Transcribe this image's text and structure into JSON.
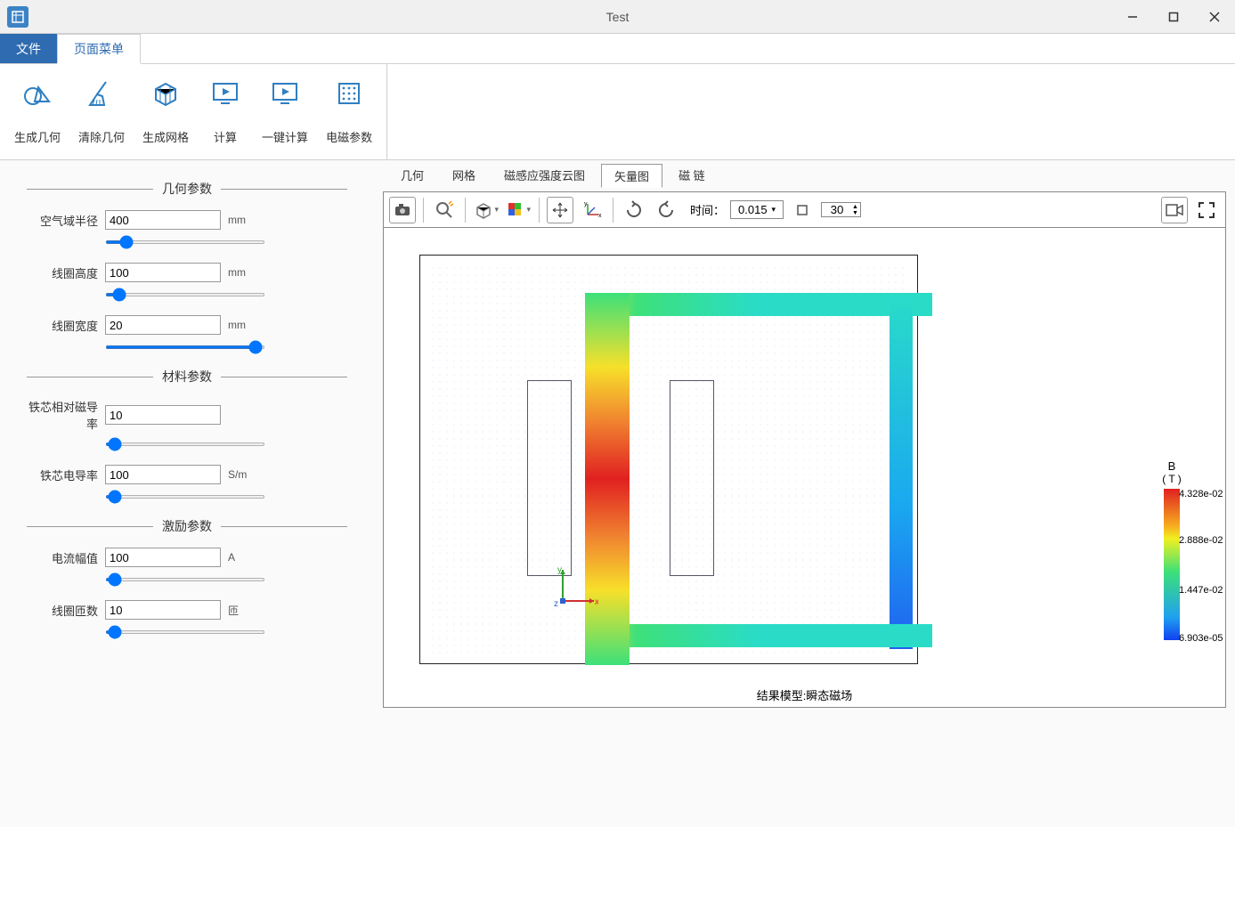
{
  "window": {
    "title": "Test"
  },
  "menubar": {
    "file": "文件",
    "page_menu": "页面菜单"
  },
  "ribbon": {
    "gen_geom": "生成几何",
    "clear_geom": "清除几何",
    "gen_mesh": "生成网格",
    "compute": "计算",
    "onekey": "一键计算",
    "em_params": "电磁参数"
  },
  "sections": {
    "geom": "几何参数",
    "material": "材料参数",
    "excitation": "激励参数"
  },
  "params": {
    "air_radius": {
      "label": "空气域半径",
      "value": "400",
      "unit": "mm"
    },
    "coil_height": {
      "label": "线圈高度",
      "value": "100",
      "unit": "mm"
    },
    "coil_width": {
      "label": "线圈宽度",
      "value": "20",
      "unit": "mm"
    },
    "perm": {
      "label": "铁芯相对磁导率",
      "value": "10",
      "unit": ""
    },
    "conduct": {
      "label": "铁芯电导率",
      "value": "100",
      "unit": "S/m"
    },
    "curr_amp": {
      "label": "电流幅值",
      "value": "100",
      "unit": "A"
    },
    "turns": {
      "label": "线圈匝数",
      "value": "10",
      "unit": "匝"
    }
  },
  "result_tabs": {
    "geom": "几何",
    "mesh": "网格",
    "bcontour": "磁感应强度云图",
    "vector": "矢量图",
    "flux": "磁 链"
  },
  "toolbar": {
    "time_label": "时间：",
    "time_value": "0.015",
    "frame": "30"
  },
  "legend": {
    "title1": "B",
    "title2": "( T )",
    "t0": "4.328e-02",
    "t1": "2.888e-02",
    "t2": "1.447e-02",
    "t3": "6.903e-05"
  },
  "caption": "结果模型:瞬态磁场",
  "axes": {
    "x": "x",
    "y": "y",
    "z": "z"
  }
}
